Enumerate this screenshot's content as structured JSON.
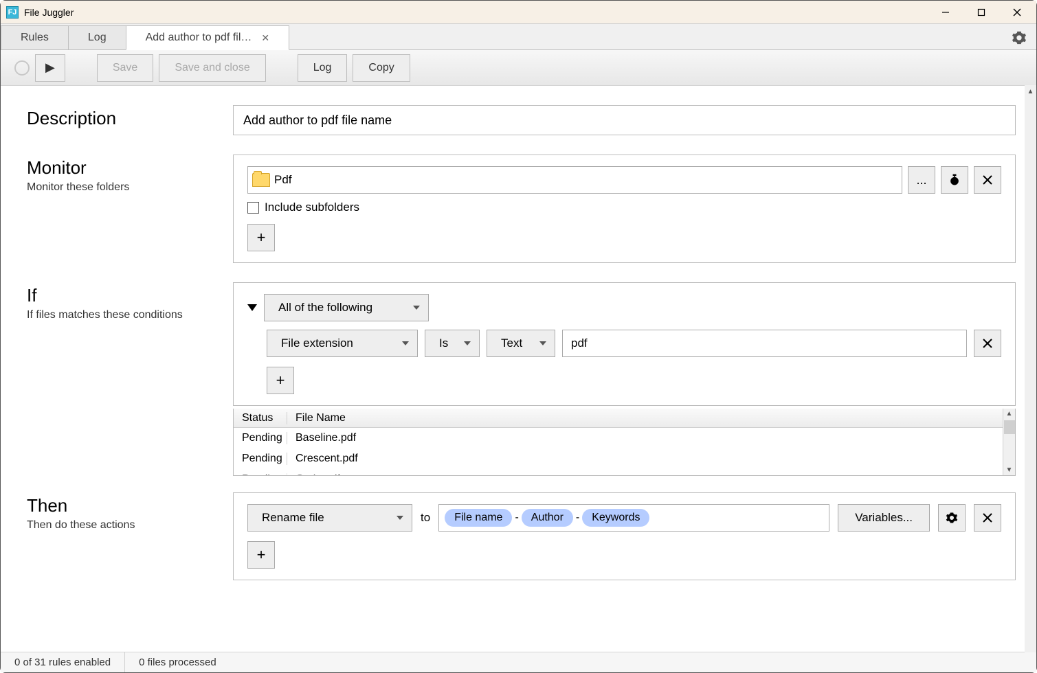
{
  "window": {
    "title": "File Juggler",
    "appIconText": "FJ"
  },
  "tabs": {
    "rules": "Rules",
    "log": "Log",
    "active": "Add author to pdf fil…"
  },
  "toolbar": {
    "save": "Save",
    "saveClose": "Save and close",
    "log": "Log",
    "copy": "Copy"
  },
  "description": {
    "label": "Description",
    "value": "Add author to pdf file name"
  },
  "monitor": {
    "label": "Monitor",
    "sub": "Monitor these folders",
    "folder": "Pdf",
    "browse": "...",
    "includeSub": "Include subfolders"
  },
  "if": {
    "label": "If",
    "sub": "If files matches these conditions",
    "group": "All of the following",
    "cond": {
      "attr": "File extension",
      "op": "Is",
      "type": "Text",
      "value": "pdf"
    },
    "table": {
      "headStatus": "Status",
      "headFile": "File Name",
      "rows": [
        {
          "status": "Pending",
          "file": "Baseline.pdf"
        },
        {
          "status": "Pending",
          "file": "Crescent.pdf"
        },
        {
          "status": "Pending",
          "file": "Curio.pdf"
        }
      ]
    }
  },
  "then": {
    "label": "Then",
    "sub": "Then do these actions",
    "action": "Rename file",
    "to": "to",
    "tokens": [
      "File name",
      "Author",
      "Keywords"
    ],
    "vars": "Variables..."
  },
  "status": {
    "rules": "0 of 31 rules enabled",
    "files": "0 files processed"
  }
}
